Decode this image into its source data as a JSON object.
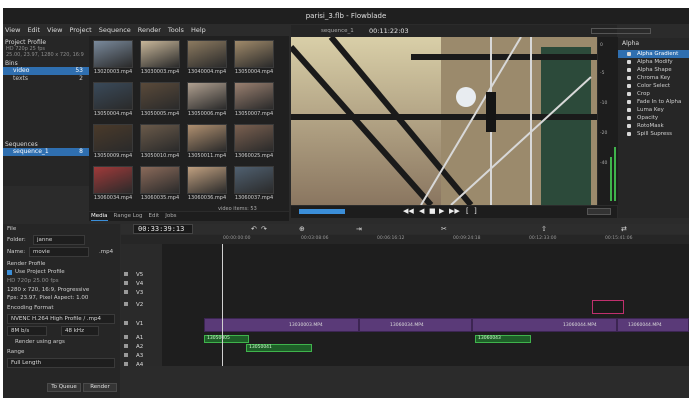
{
  "window": {
    "title": "parisi_3.flb - Flowblade"
  },
  "menu": [
    "View",
    "Edit",
    "View",
    "Project",
    "Sequence",
    "Render",
    "Tools",
    "Help"
  ],
  "project": {
    "title": "Project Profile",
    "profile": "HD 720p 25 fps",
    "profile_detail": "25.00, 23.97, 1280 x 720, 16:9",
    "bins_header": "Bins",
    "bins": [
      {
        "name": "video",
        "count": "53"
      },
      {
        "name": "texts",
        "count": "2"
      }
    ],
    "sequences_header": "Sequences",
    "sequences": [
      {
        "name": "sequence_1",
        "count": "8"
      }
    ]
  },
  "media": {
    "items": [
      "13020003.mp4",
      "13030003.mp4",
      "13040004.mp4",
      "13050004.mp4",
      "13050004.mp4",
      "13050005.mp4",
      "13050006.mp4",
      "13050007.mp4",
      "13050009.mp4",
      "13050010.mp4",
      "13050011.mp4",
      "13060025.mp4",
      "13060034.mp4",
      "13060035.mp4",
      "13060036.mp4",
      "13060037.mp4"
    ],
    "tabs": [
      "Media",
      "Range Log",
      "Edit",
      "Jobs"
    ],
    "footer": "video  items: 53"
  },
  "viewer": {
    "sequence_label": "sequence_1",
    "timecode": "00:11:22:03",
    "meter_scale": [
      "0",
      "-5",
      "-10",
      "-20",
      "-40"
    ]
  },
  "effects": {
    "category": "Alpha",
    "items": [
      "Alpha Gradient",
      "Alpha Modify",
      "Alpha Shape",
      "Chroma Key",
      "Color Select",
      "Crop",
      "Fade In to Alpha",
      "Luma Key",
      "Opacity",
      "RotoMask",
      "Spill Supress"
    ],
    "selected": 0
  },
  "render": {
    "file_label": "File",
    "folder_label": "Folder:",
    "folder_value": "janne",
    "name_label": "Name:",
    "name_value": "movie",
    "ext": ".mp4",
    "profile_header": "Render Profile",
    "use_project_profile": "Use Project Profile",
    "profile_name": "HD 720p 25.00 fps",
    "profile_line1": "1280 x 720, 16:9, Progressive",
    "profile_line2": "Fps: 23.97, Pixel Aspect: 1.00",
    "encoding_header": "Encoding Format",
    "encoding_value": "NVENC H.264 High Profile / .mp4",
    "bitrate_value": "8M b/s",
    "audio_value": "48 kHz",
    "using_args": "Render using args",
    "range_header": "Range",
    "range_value": "Full Length",
    "to_queue": "To Queue",
    "render_btn": "Render"
  },
  "timeline": {
    "timecode": "00:33:39:13",
    "ruler_labels": [
      "00:00:00:00",
      "00:03:08:06",
      "00:06:16:12",
      "00:09:24:18",
      "00:12:33:00",
      "00:15:41:06"
    ],
    "video_tracks": [
      "V5",
      "V4",
      "V3",
      "V2",
      "V1"
    ],
    "audio_tracks": [
      "A1",
      "A2",
      "A3",
      "A4"
    ],
    "v1_clips": [
      "13030003.MP4",
      "13060034.MP4",
      "13060044.MP4",
      "13060044.MP4"
    ],
    "a1_clips": [
      "13050005",
      "13060043"
    ],
    "a2_clips": [
      "13050041"
    ]
  },
  "colors": {
    "accent": "#2f6fb0",
    "clip_video": "#5a3a78",
    "clip_audio": "#1e5f28"
  }
}
